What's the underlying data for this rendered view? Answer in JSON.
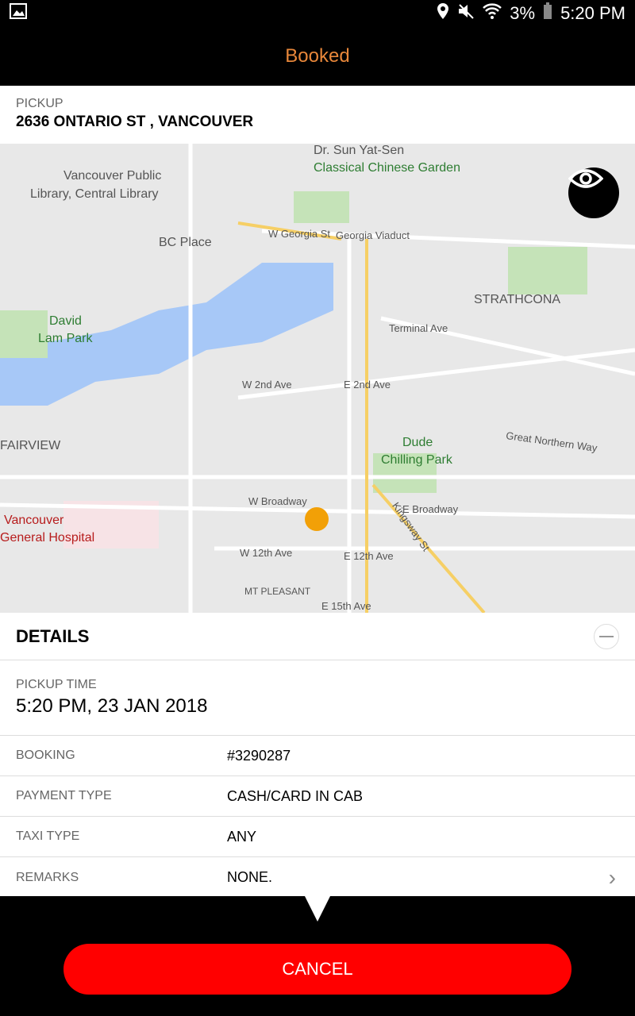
{
  "status_bar": {
    "battery": "3%",
    "time": "5:20 PM",
    "icons": [
      "image-icon",
      "location-icon",
      "mute-icon",
      "wifi-icon",
      "battery-icon"
    ]
  },
  "app_bar": {
    "title": "Booked",
    "title_color": "#e8873a"
  },
  "pickup": {
    "label": "PICKUP",
    "address": "2636 ONTARIO ST , VANCOUVER"
  },
  "map": {
    "labels": [
      "Dr. Sun Yat-Sen",
      "Classical Chinese Garden",
      "Vancouver Public",
      "Library, Central Library",
      "BC Place",
      "W Georgia St",
      "Georgia Viaduct",
      "STRATHCONA",
      "David",
      "Lam Park",
      "Terminal Ave",
      "W 2nd Ave",
      "E 2nd Ave",
      "FAIRVIEW",
      "Dude",
      "Chilling Park",
      "W Broadway",
      "E Broadway",
      "Vancouver",
      "General Hospital",
      "W 12th Ave",
      "E 12th Ave",
      "MT PLEASANT",
      "E 15th Ave",
      "Kingsway St",
      "Great Northern Way"
    ]
  },
  "details": {
    "title": "DETAILS",
    "pickup_time_label": "PICKUP TIME",
    "pickup_time": "5:20 PM, 23 JAN 2018",
    "rows": [
      {
        "label": "BOOKING",
        "value": "#3290287"
      },
      {
        "label": "PAYMENT TYPE",
        "value": "CASH/CARD IN CAB"
      },
      {
        "label": "TAXI TYPE",
        "value": "ANY"
      },
      {
        "label": "REMARKS",
        "value": "NONE."
      }
    ]
  },
  "cancel_label": "CANCEL",
  "cancel_color": "#ff0000"
}
